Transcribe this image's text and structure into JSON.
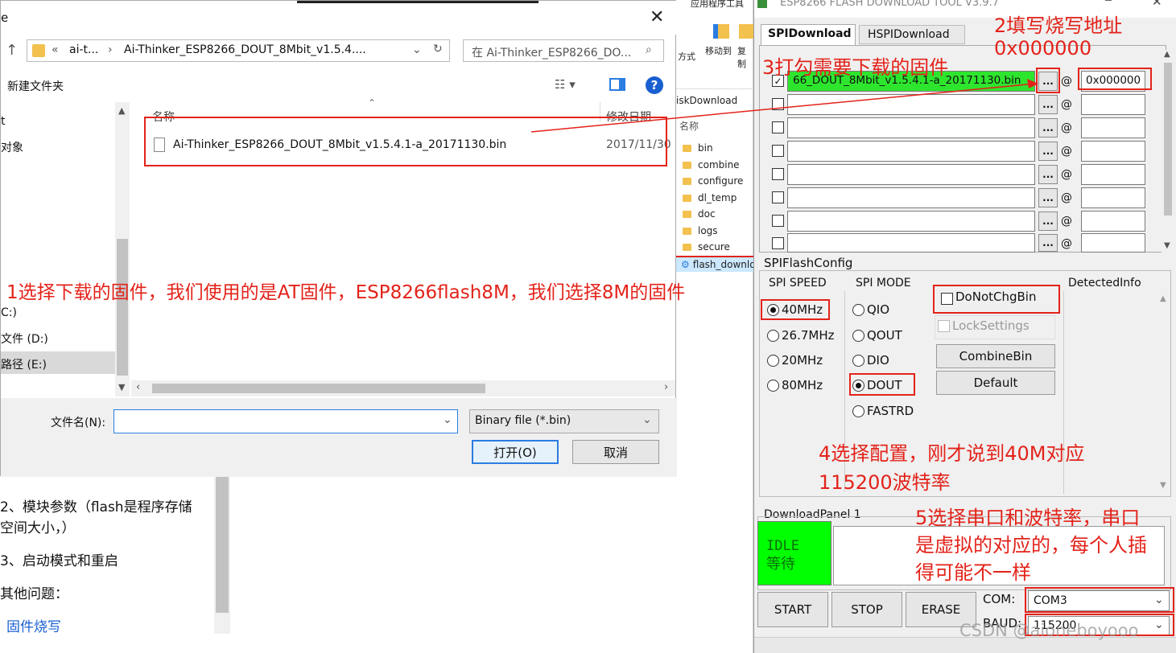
{
  "bg_blog": {
    "items": [
      "2、模块参数（flash是程序存储",
      "空间大小，）",
      "3、启动模式和重启",
      "其他问题：",
      "固件烧写"
    ]
  },
  "explorer": {
    "columns": [
      "名称"
    ],
    "ribbon_group": "应用程序工具",
    "ribbon_labels": [
      "方式",
      "移动到",
      "复制"
    ],
    "breadcrumb": "iskDownload",
    "folders": [
      "bin",
      "combine",
      "configure",
      "dl_temp",
      "doc",
      "logs",
      "secure"
    ],
    "selected_file": "flash_downlo"
  },
  "dialog": {
    "title_char": "e",
    "path_parts": [
      "«",
      "ai-t...",
      "›",
      "Ai-Thinker_ESP8266_DOUT_8Mbit_v1.5.4...."
    ],
    "search_placeholder": "在 Ai-Thinker_ESP8266_DO...",
    "new_folder": "新建文件夹",
    "col_name": "名称",
    "col_date": "修改日期",
    "file_name": "Ai-Thinker_ESP8266_DOUT_8Mbit_v1.5.4.1-a_20171130.bin",
    "file_date": "2017/11/30",
    "nav_items": [
      "t",
      "对象",
      "C:)",
      "文件 (D:)",
      "路径 (E:)"
    ],
    "filename_label": "文件名(N):",
    "filename_value": "",
    "filetype": "Binary file (*.bin)",
    "open_button": "打开(O)",
    "cancel_button": "取消"
  },
  "tool": {
    "title": "ESP8266 FLASH DOWNLOAD TOOL V3.9.7",
    "tabs": [
      "SPIDownload",
      "HSPIDownload"
    ],
    "rows": [
      {
        "checked": true,
        "file": "66_DOUT_8Mbit_v1.5.4.1-a_20171130.bin",
        "addr": "0x000000"
      },
      {
        "checked": false,
        "file": "",
        "addr": ""
      },
      {
        "checked": false,
        "file": "",
        "addr": ""
      },
      {
        "checked": false,
        "file": "",
        "addr": ""
      },
      {
        "checked": false,
        "file": "",
        "addr": ""
      },
      {
        "checked": false,
        "file": "",
        "addr": ""
      },
      {
        "checked": false,
        "file": "",
        "addr": ""
      },
      {
        "checked": false,
        "file": "",
        "addr": ""
      }
    ],
    "dots_label": "...",
    "at_label": "@",
    "flash_config": "SPIFlashConfig",
    "spi_speed_label": "SPI SPEED",
    "spi_speeds": [
      "40MHz",
      "26.7MHz",
      "20MHz",
      "80MHz"
    ],
    "spi_speed_selected": "40MHz",
    "spi_mode_label": "SPI MODE",
    "spi_modes": [
      "QIO",
      "QOUT",
      "DIO",
      "DOUT",
      "FASTRD"
    ],
    "spi_mode_selected": "DOUT",
    "do_not_chg_bin": "DoNotChgBin",
    "lock_settings": "LockSettings",
    "combine_bin": "CombineBin",
    "default_btn": "Default",
    "detected_info": "DetectedInfo",
    "download_panel": "DownloadPanel 1",
    "status_en": "IDLE",
    "status_cn": "等待",
    "status_color": "#00ff00",
    "start": "START",
    "stop": "STOP",
    "erase": "ERASE",
    "com_label": "COM:",
    "com_value": "COM3",
    "baud_label": "BAUD:",
    "baud_value": "115200"
  },
  "annotations": {
    "a1": "1选择下载的固件，我们使用的是AT固件，ESP8266flash8M，我们选择8M的固件",
    "a2_line1": "2填写烧写地址",
    "a2_line2": "0x000000",
    "a3": "3打勾需要下载的固件",
    "a4_line1": "4选择配置，刚才说到40M对应",
    "a4_line2": "115200波特率",
    "a5_line1": "5选择串口和波特率，串口",
    "a5_line2": "是虚拟的对应的，每个人插",
    "a5_line3": "得可能不一样",
    "color": "#e3231a"
  },
  "watermark": "CSDN @aioneboyooo"
}
